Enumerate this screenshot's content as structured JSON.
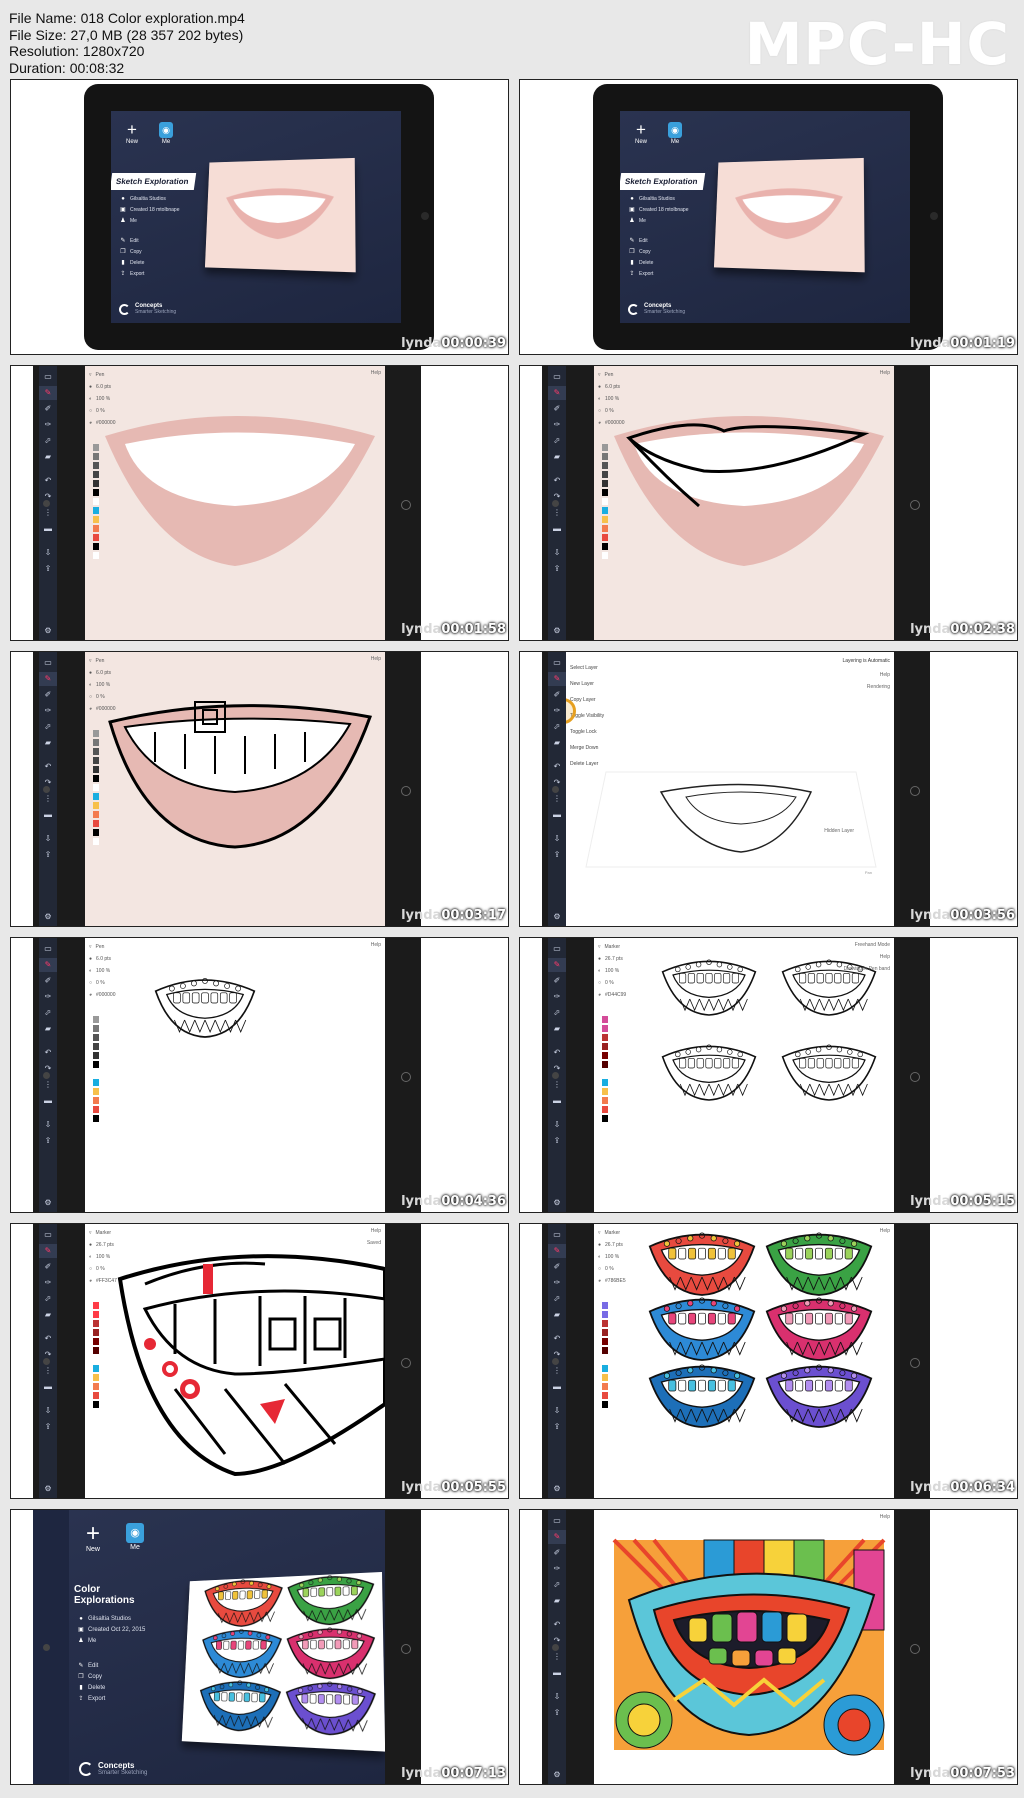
{
  "header": {
    "file_name": "File Name: 018 Color exploration.mp4",
    "file_size": "File Size: 27,0 MB (28 357 202 bytes)",
    "resolution": "Resolution: 1280x720",
    "duration": "Duration: 00:08:32"
  },
  "logo": "MPC-HC",
  "brand": "lynda",
  "thumbnails": [
    {
      "time": "00:00:39",
      "kind": "home"
    },
    {
      "time": "00:01:19",
      "kind": "home"
    },
    {
      "time": "00:01:58",
      "kind": "photo"
    },
    {
      "time": "00:02:38",
      "kind": "photo-outline"
    },
    {
      "time": "00:03:17",
      "kind": "photo-teeth"
    },
    {
      "time": "00:03:56",
      "kind": "layers"
    },
    {
      "time": "00:04:36",
      "kind": "single-lips"
    },
    {
      "time": "00:05:15",
      "kind": "four-lips"
    },
    {
      "time": "00:05:55",
      "kind": "zoom-lips"
    },
    {
      "time": "00:06:34",
      "kind": "six-color"
    },
    {
      "time": "00:07:13",
      "kind": "home-color"
    },
    {
      "time": "00:07:53",
      "kind": "full-art"
    }
  ],
  "home": {
    "new_label": "New",
    "me_label": "Me",
    "sketch_title": "Sketch Exploration",
    "color_title": "Color Explorations",
    "studio": "Gilsaltia Studios",
    "created": "Created 18 mtolbnape",
    "created_2": "Created Oct 22, 2015",
    "me": "Me",
    "edit": "Edit",
    "copy": "Copy",
    "delete": "Delete",
    "export": "Export",
    "brand_line1": "Concepts",
    "brand_line2": "Smarter Sketching"
  },
  "tool": {
    "pen": "Pen",
    "marker": "Marker",
    "size_pen": "6.0 pts",
    "size_marker": "26.7 pts",
    "opacity": "100 %",
    "smooth": "0 %",
    "color_black": "#000000",
    "color_pink": "#D44C99",
    "color_red": "#FF3C47",
    "color_purple": "#786BE5",
    "help": "Help",
    "freehand": "Freehand Mode",
    "drawing_in": "Drawing in Pen band",
    "saved": "Saved"
  },
  "layers_menu": {
    "select": "Select Layer",
    "new": "New Layer",
    "copy": "Copy Layer",
    "toggle_vis": "Toggle Visibility",
    "toggle_lock": "Toggle Lock",
    "merge": "Merge Down",
    "delete": "Delete Layer",
    "layering": "Layering is Automatic",
    "help": "Help",
    "rendering": "Rendering",
    "hidden_layer": "Hidden Layer",
    "bottom": "Pan"
  },
  "colors": {
    "accent_pink": "#ff3b6b",
    "app_dark": "#222836",
    "home_bg": "#2a3350",
    "timestamp": "#ffffff"
  }
}
